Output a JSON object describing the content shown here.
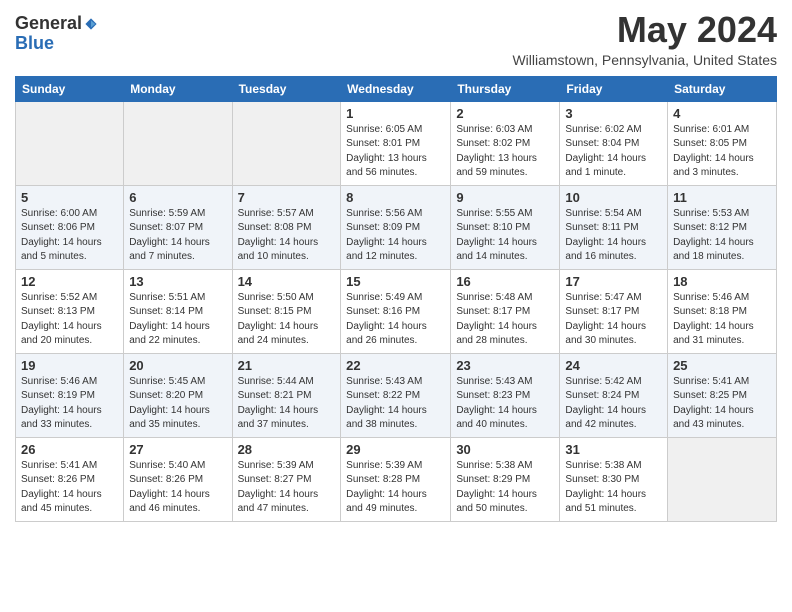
{
  "header": {
    "logo_general": "General",
    "logo_blue": "Blue",
    "month_title": "May 2024",
    "location": "Williamstown, Pennsylvania, United States"
  },
  "weekdays": [
    "Sunday",
    "Monday",
    "Tuesday",
    "Wednesday",
    "Thursday",
    "Friday",
    "Saturday"
  ],
  "weeks": [
    [
      {
        "day": "",
        "detail": ""
      },
      {
        "day": "",
        "detail": ""
      },
      {
        "day": "",
        "detail": ""
      },
      {
        "day": "1",
        "detail": "Sunrise: 6:05 AM\nSunset: 8:01 PM\nDaylight: 13 hours\nand 56 minutes."
      },
      {
        "day": "2",
        "detail": "Sunrise: 6:03 AM\nSunset: 8:02 PM\nDaylight: 13 hours\nand 59 minutes."
      },
      {
        "day": "3",
        "detail": "Sunrise: 6:02 AM\nSunset: 8:04 PM\nDaylight: 14 hours\nand 1 minute."
      },
      {
        "day": "4",
        "detail": "Sunrise: 6:01 AM\nSunset: 8:05 PM\nDaylight: 14 hours\nand 3 minutes."
      }
    ],
    [
      {
        "day": "5",
        "detail": "Sunrise: 6:00 AM\nSunset: 8:06 PM\nDaylight: 14 hours\nand 5 minutes."
      },
      {
        "day": "6",
        "detail": "Sunrise: 5:59 AM\nSunset: 8:07 PM\nDaylight: 14 hours\nand 7 minutes."
      },
      {
        "day": "7",
        "detail": "Sunrise: 5:57 AM\nSunset: 8:08 PM\nDaylight: 14 hours\nand 10 minutes."
      },
      {
        "day": "8",
        "detail": "Sunrise: 5:56 AM\nSunset: 8:09 PM\nDaylight: 14 hours\nand 12 minutes."
      },
      {
        "day": "9",
        "detail": "Sunrise: 5:55 AM\nSunset: 8:10 PM\nDaylight: 14 hours\nand 14 minutes."
      },
      {
        "day": "10",
        "detail": "Sunrise: 5:54 AM\nSunset: 8:11 PM\nDaylight: 14 hours\nand 16 minutes."
      },
      {
        "day": "11",
        "detail": "Sunrise: 5:53 AM\nSunset: 8:12 PM\nDaylight: 14 hours\nand 18 minutes."
      }
    ],
    [
      {
        "day": "12",
        "detail": "Sunrise: 5:52 AM\nSunset: 8:13 PM\nDaylight: 14 hours\nand 20 minutes."
      },
      {
        "day": "13",
        "detail": "Sunrise: 5:51 AM\nSunset: 8:14 PM\nDaylight: 14 hours\nand 22 minutes."
      },
      {
        "day": "14",
        "detail": "Sunrise: 5:50 AM\nSunset: 8:15 PM\nDaylight: 14 hours\nand 24 minutes."
      },
      {
        "day": "15",
        "detail": "Sunrise: 5:49 AM\nSunset: 8:16 PM\nDaylight: 14 hours\nand 26 minutes."
      },
      {
        "day": "16",
        "detail": "Sunrise: 5:48 AM\nSunset: 8:17 PM\nDaylight: 14 hours\nand 28 minutes."
      },
      {
        "day": "17",
        "detail": "Sunrise: 5:47 AM\nSunset: 8:17 PM\nDaylight: 14 hours\nand 30 minutes."
      },
      {
        "day": "18",
        "detail": "Sunrise: 5:46 AM\nSunset: 8:18 PM\nDaylight: 14 hours\nand 31 minutes."
      }
    ],
    [
      {
        "day": "19",
        "detail": "Sunrise: 5:46 AM\nSunset: 8:19 PM\nDaylight: 14 hours\nand 33 minutes."
      },
      {
        "day": "20",
        "detail": "Sunrise: 5:45 AM\nSunset: 8:20 PM\nDaylight: 14 hours\nand 35 minutes."
      },
      {
        "day": "21",
        "detail": "Sunrise: 5:44 AM\nSunset: 8:21 PM\nDaylight: 14 hours\nand 37 minutes."
      },
      {
        "day": "22",
        "detail": "Sunrise: 5:43 AM\nSunset: 8:22 PM\nDaylight: 14 hours\nand 38 minutes."
      },
      {
        "day": "23",
        "detail": "Sunrise: 5:43 AM\nSunset: 8:23 PM\nDaylight: 14 hours\nand 40 minutes."
      },
      {
        "day": "24",
        "detail": "Sunrise: 5:42 AM\nSunset: 8:24 PM\nDaylight: 14 hours\nand 42 minutes."
      },
      {
        "day": "25",
        "detail": "Sunrise: 5:41 AM\nSunset: 8:25 PM\nDaylight: 14 hours\nand 43 minutes."
      }
    ],
    [
      {
        "day": "26",
        "detail": "Sunrise: 5:41 AM\nSunset: 8:26 PM\nDaylight: 14 hours\nand 45 minutes."
      },
      {
        "day": "27",
        "detail": "Sunrise: 5:40 AM\nSunset: 8:26 PM\nDaylight: 14 hours\nand 46 minutes."
      },
      {
        "day": "28",
        "detail": "Sunrise: 5:39 AM\nSunset: 8:27 PM\nDaylight: 14 hours\nand 47 minutes."
      },
      {
        "day": "29",
        "detail": "Sunrise: 5:39 AM\nSunset: 8:28 PM\nDaylight: 14 hours\nand 49 minutes."
      },
      {
        "day": "30",
        "detail": "Sunrise: 5:38 AM\nSunset: 8:29 PM\nDaylight: 14 hours\nand 50 minutes."
      },
      {
        "day": "31",
        "detail": "Sunrise: 5:38 AM\nSunset: 8:30 PM\nDaylight: 14 hours\nand 51 minutes."
      },
      {
        "day": "",
        "detail": ""
      }
    ]
  ],
  "row_classes": [
    "row-white",
    "row-light",
    "row-white",
    "row-light",
    "row-white"
  ]
}
